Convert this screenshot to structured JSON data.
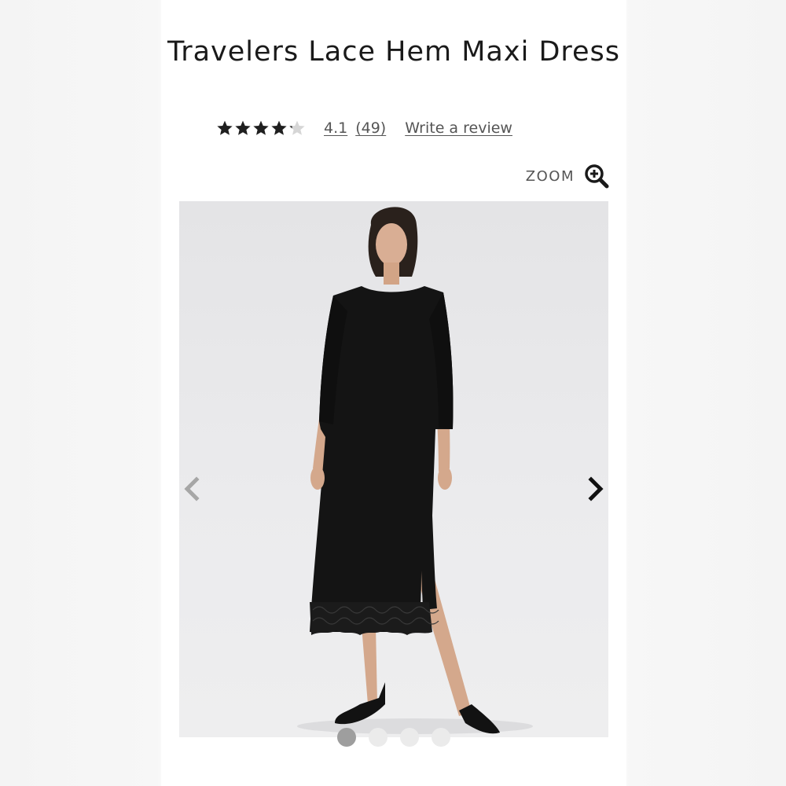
{
  "product": {
    "title": "Travelers Lace Hem Maxi Dress"
  },
  "rating": {
    "value_label": "4.1",
    "count_label": "(49)",
    "stars_value": 4.1,
    "stars_max": 5,
    "write_review_label": "Write a review"
  },
  "zoom": {
    "label": "ZOOM",
    "icon": "zoom-in-icon"
  },
  "gallery": {
    "image_count": 4,
    "active_index": 0,
    "prev_icon": "chevron-left-icon",
    "next_icon": "chevron-right-icon"
  },
  "colors": {
    "text": "#1c1c1c",
    "link": "#555555",
    "star_filled": "#1f1f1f",
    "star_empty": "#d6d6d6",
    "dot_active": "#9e9e9e",
    "dot_inactive": "#ebebeb"
  }
}
